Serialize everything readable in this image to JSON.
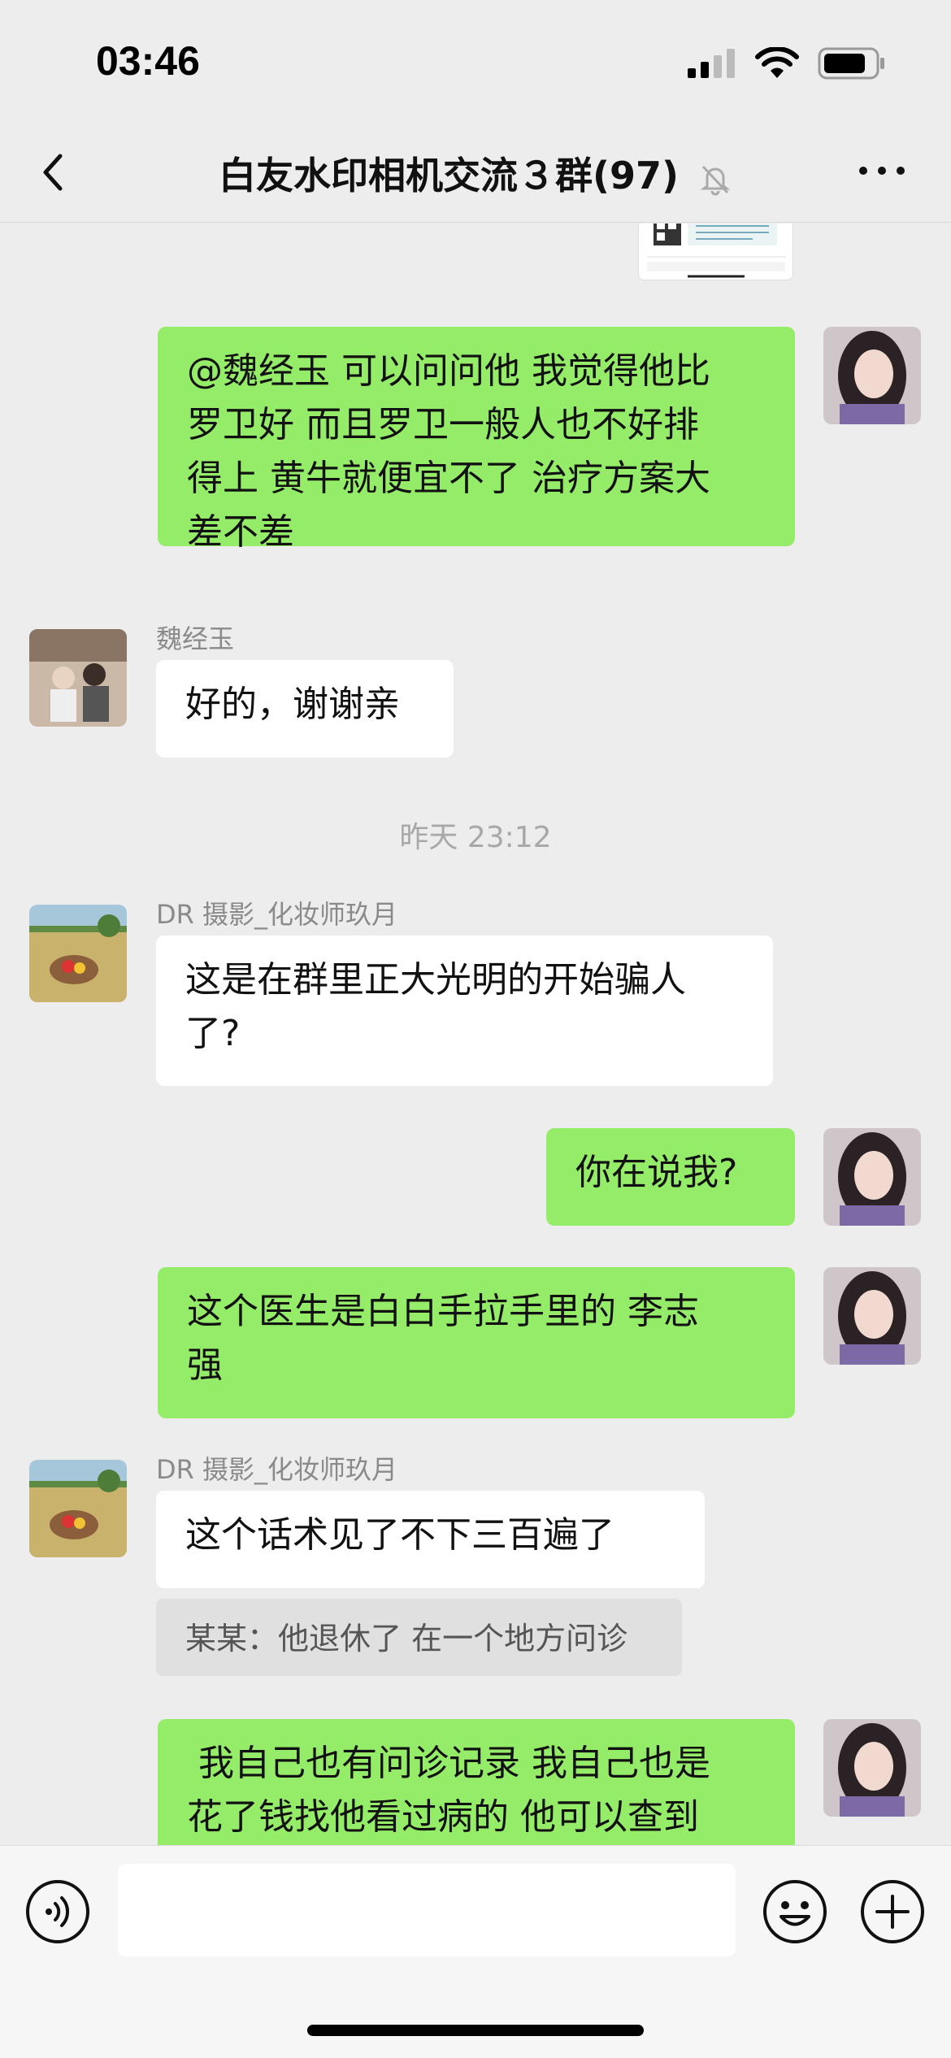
{
  "status_bar": {
    "time": "03:46",
    "icons": [
      "signal-icon",
      "wifi-icon",
      "battery-icon"
    ]
  },
  "header": {
    "title": "白友水印相机交流３群(97)",
    "back_icon": "chevron-left-icon",
    "mute_icon": "bell-slash-icon",
    "more_icon": "more-dots-icon"
  },
  "messages": [
    {
      "type": "image",
      "side": "right",
      "description_icon": "shared-screenshot-thumbnail"
    },
    {
      "type": "text",
      "side": "right",
      "lines": [
        "@魏经玉 可以问问他 我觉得他比",
        "罗卫好 而且罗卫一般人也不好排",
        "得上 黄牛就便宜不了 治疗方案大",
        "差不差"
      ]
    },
    {
      "type": "text",
      "side": "left",
      "sender": "魏经玉",
      "lines": [
        "好的，谢谢亲"
      ]
    },
    {
      "type": "timestamp",
      "text": "昨天 23:12"
    },
    {
      "type": "text",
      "side": "left",
      "sender": "DR 摄影_化妆师玖月",
      "lines": [
        "这是在群里正大光明的开始骗人",
        "了?"
      ]
    },
    {
      "type": "text",
      "side": "right",
      "lines": [
        "你在说我?"
      ]
    },
    {
      "type": "text",
      "side": "right",
      "lines": [
        "这个医生是白白手拉手里的  李志",
        "强"
      ]
    },
    {
      "type": "text",
      "side": "left",
      "sender": "DR 摄影_化妆师玖月",
      "lines": [
        "这个话术见了不下三百遍了"
      ],
      "quote": "某某：他退休了 在一个地方问诊"
    },
    {
      "type": "text",
      "side": "right",
      "lines": [
        " 我自己也有问诊记录 我自己也是",
        "花了钱找他看过病的 他可以查到"
      ]
    }
  ],
  "input_bar": {
    "voice_icon": "voice-icon",
    "emoji_icon": "emoji-icon",
    "plus_icon": "plus-circle-icon",
    "text_value": ""
  },
  "colors": {
    "background": "#ededed",
    "own_bubble": "#95ec69",
    "other_bubble": "#ffffff",
    "quote_bg": "#e0e0e0"
  }
}
